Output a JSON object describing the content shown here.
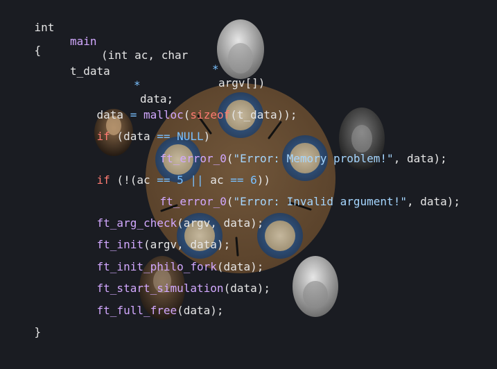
{
  "theme": {
    "background": "#1a1c22",
    "keyword_red": "#ff7b72",
    "function_purple": "#d2a8ff",
    "string_blue": "#a5d6ff",
    "operator_blue": "#79c0ff",
    "plain_text": "#e6e6e6",
    "table_wood": "#a67642"
  },
  "code": {
    "line1": {
      "type": "int",
      "fn": "main",
      "args": "(int ac, char ",
      "star": "*",
      "args2": "argv[])"
    },
    "line2": {
      "brace_open": "{"
    },
    "line3": {
      "type": "t_data",
      "star": "*",
      "var": "data;"
    },
    "line4": {
      "lhs": "data ",
      "eq": "=",
      "fn": " malloc",
      "p1": "(",
      "kw": "sizeof",
      "rest": "(t_data));"
    },
    "line5": {
      "kw": "if",
      "open": " (data ",
      "op": "==",
      "null": " NULL",
      "close": ")"
    },
    "line6": {
      "fn": "ft_error_0",
      "open": "(",
      "str": "\"Error: Memory problem!\"",
      "rest": ", data);"
    },
    "line7": {
      "kw": "if",
      "a": " (!(ac ",
      "op1": "==",
      "n1": " 5",
      "op2": " ||",
      "b": " ac ",
      "op3": "==",
      "n2": " 6",
      "close": "))"
    },
    "line8": {
      "fn": "ft_error_0",
      "open": "(",
      "str": "\"Error: Invalid argument!\"",
      "rest": ", data);"
    },
    "line9": {
      "fn": "ft_arg_check",
      "rest": "(argv, data);"
    },
    "line10": {
      "fn": "ft_init",
      "rest": "(argv, data);"
    },
    "line11": {
      "fn": "ft_init_philo_fork",
      "rest": "(data);"
    },
    "line12": {
      "fn": "ft_start_simulation",
      "rest": "(data);"
    },
    "line13": {
      "fn": "ft_full_free",
      "rest": "(data);"
    },
    "line14": {
      "brace_close": "}"
    }
  },
  "illustration": {
    "table": "round-wooden-table",
    "plates": [
      "spaghetti-plate-1",
      "spaghetti-plate-2",
      "spaghetti-plate-3",
      "spaghetti-plate-4",
      "spaghetti-plate-5"
    ],
    "forks": [
      "fork-1",
      "fork-2",
      "fork-3",
      "fork-4",
      "fork-5"
    ],
    "philosophers": [
      "philosopher-bust-top",
      "philosopher-portrait-left",
      "philosopher-statue-right",
      "philosopher-portrait-bottom-left",
      "philosopher-bust-bottom-right"
    ]
  }
}
